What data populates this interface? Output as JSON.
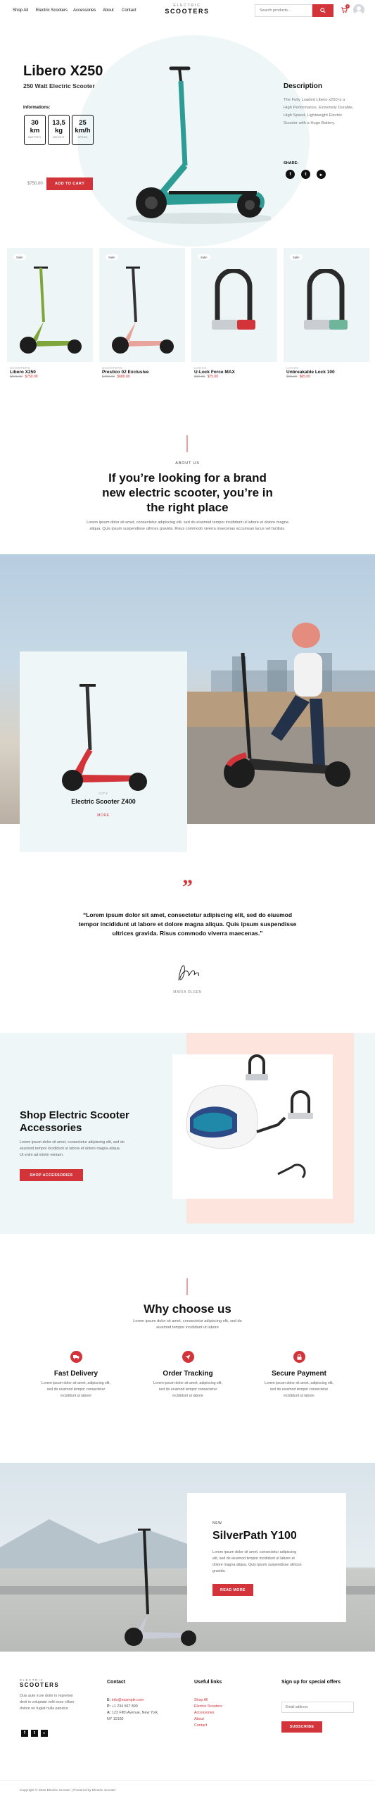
{
  "header": {
    "nav": [
      "Shop All",
      "Electric Scooters",
      "Accessories",
      "About",
      "Contact"
    ],
    "logo_small": "ELECTRIC",
    "logo_big": "SCOOTERS",
    "search_placeholder": "Search products...",
    "cart_count": "0"
  },
  "hero": {
    "title": "Libero X250",
    "subtitle": "250 Watt Electric Scooter",
    "info_label": "Informations:",
    "specs": [
      {
        "value": "30",
        "unit": "km",
        "label": "BATTERY"
      },
      {
        "value": "13,5",
        "unit": "kg",
        "label": "WEIGHT"
      },
      {
        "value": "25",
        "unit": "km/h",
        "label": "SPEED"
      }
    ],
    "price": "$750.00",
    "cta": "ADD TO CART",
    "desc_title": "Description",
    "desc_text": "The Fully Loaded Libero x250 is a High Performance, Extremely Durable, High Speed, Lightweight Electric Scooter with a Huge Battery.",
    "share_label": "SHARE:",
    "social_icons": [
      "facebook-icon",
      "twitter-icon",
      "youtube-icon"
    ]
  },
  "products": [
    {
      "badge": "Sale!",
      "category": "SCOOTERS",
      "name": "Libero X250",
      "old_price": "$875.00",
      "price": "$750.00"
    },
    {
      "badge": "Sale!",
      "category": "SCOOTERS",
      "name": "Prestico 02 Exclusive",
      "old_price": "$750.00",
      "price": "$680.00"
    },
    {
      "badge": "Sale!",
      "category": "LOCKS",
      "name": "U-Lock Force MAX",
      "old_price": "$90.00",
      "price": "$75.00"
    },
    {
      "badge": "Sale!",
      "category": "LOCKS",
      "name": "Unbreakable Lock 100",
      "old_price": "$95.00",
      "price": "$65.00"
    }
  ],
  "about": {
    "eyebrow": "ABOUT US",
    "title_lines": [
      "If you’re looking for a brand",
      "new electric scooter, you’re in",
      "the right place"
    ],
    "text_lines": [
      "Lorem ipsum dolor sit amet, consectetur adipiscing elit, sed do eiusmod tempor incididunt ut labore et dolore magna",
      "aliqua. Quis ipsum suspendisse ultrices gravida. Risus commodo viverra maecenas accumsan lacus vel facilisis."
    ]
  },
  "featured": {
    "category": "CITY",
    "name": "Electric Scooter Z400",
    "link": "MORE"
  },
  "quote": {
    "text_lines": [
      "“Lorem ipsum dolor sit amet, consectetur adipiscing elit, sed do eiusmod",
      "tempor incididunt ut labore et dolore magna aliqua. Quis ipsum suspendisse",
      "ultrices gravida. Risus commodo viverra maecenas.”"
    ],
    "author": "MARIA OLSEN"
  },
  "accessories": {
    "title_lines": [
      "Shop Electric Scooter",
      "Accessories"
    ],
    "text_lines": [
      "Lorem ipsum dolor sit amet, consectetur adipiscing elit, sed do",
      "eiusmod tempor incididunt ut labore et dolore magna aliqua.",
      "Ut enim ad minim veniam."
    ],
    "cta": "SHOP ACCESSORIES"
  },
  "why": {
    "title": "Why choose us",
    "text_lines": [
      "Lorem ipsum dolor sit amet, consectetur adipiscing elit, sed do",
      "eiusmod tempor incididunt ut labore"
    ],
    "features": [
      {
        "icon": "truck-icon",
        "title": "Fast Delivery",
        "lines": [
          "Lorem ipsum dolor sit amet, adipiscing elit,",
          "sed do eiusmod tempor consectetur",
          "incididunt ut labore"
        ]
      },
      {
        "icon": "navigation-icon",
        "title": "Order Tracking",
        "lines": [
          "Lorem ipsum dolor sit amet, adipiscing elit,",
          "sed do eiusmod tempor consectetur",
          "incididunt ut labore"
        ]
      },
      {
        "icon": "lock-icon",
        "title": "Secure Payment",
        "lines": [
          "Lorem ipsum dolor sit amet, adipiscing elit,",
          "sed do eiusmod tempor consectetur",
          "incididunt ut labore"
        ]
      }
    ]
  },
  "promo": {
    "eyebrow": "NEW",
    "title": "SilverPath Y100",
    "text_lines": [
      "Lorem ipsum dolor sit amet, consectetur adipiscing",
      "elit, sed do eiusmod tempor incididunt ut labore et",
      "dolore magna aliqua. Quis ipsum suspendisse ultrices",
      "gravida."
    ],
    "cta": "READ MORE"
  },
  "footer": {
    "logo_small": "ELECTRIC",
    "logo_big": "SCOOTERS",
    "about_lines": [
      "Duis aute irure dolor in reprehen",
      "derit in voluptate velit esse cillum",
      "dolore eu fugiat nulla pariatur."
    ],
    "contact_title": "Contact",
    "contact": [
      {
        "label": "E:",
        "value": "info@example.com"
      },
      {
        "label": "P:",
        "value": "+1 234 567 890"
      },
      {
        "label": "A:",
        "value": "123 Fifth Avenue, New York,"
      },
      {
        "label": "",
        "value": "NY 10160"
      }
    ],
    "links_title": "Useful links",
    "links": [
      "Shop All",
      "Electric Scooters",
      "Accessories",
      "About",
      "Contact"
    ],
    "signup_title": "Sign up for special offers",
    "email_placeholder": "Email address",
    "subscribe": "SUBSCRIBE",
    "copyright": "Copyright © 2022 Electric Scooter | Powered by Electric Scooter"
  },
  "colors": {
    "accent": "#d2343a",
    "hero_bg": "#eef6f7",
    "peach": "#fde4dc"
  }
}
